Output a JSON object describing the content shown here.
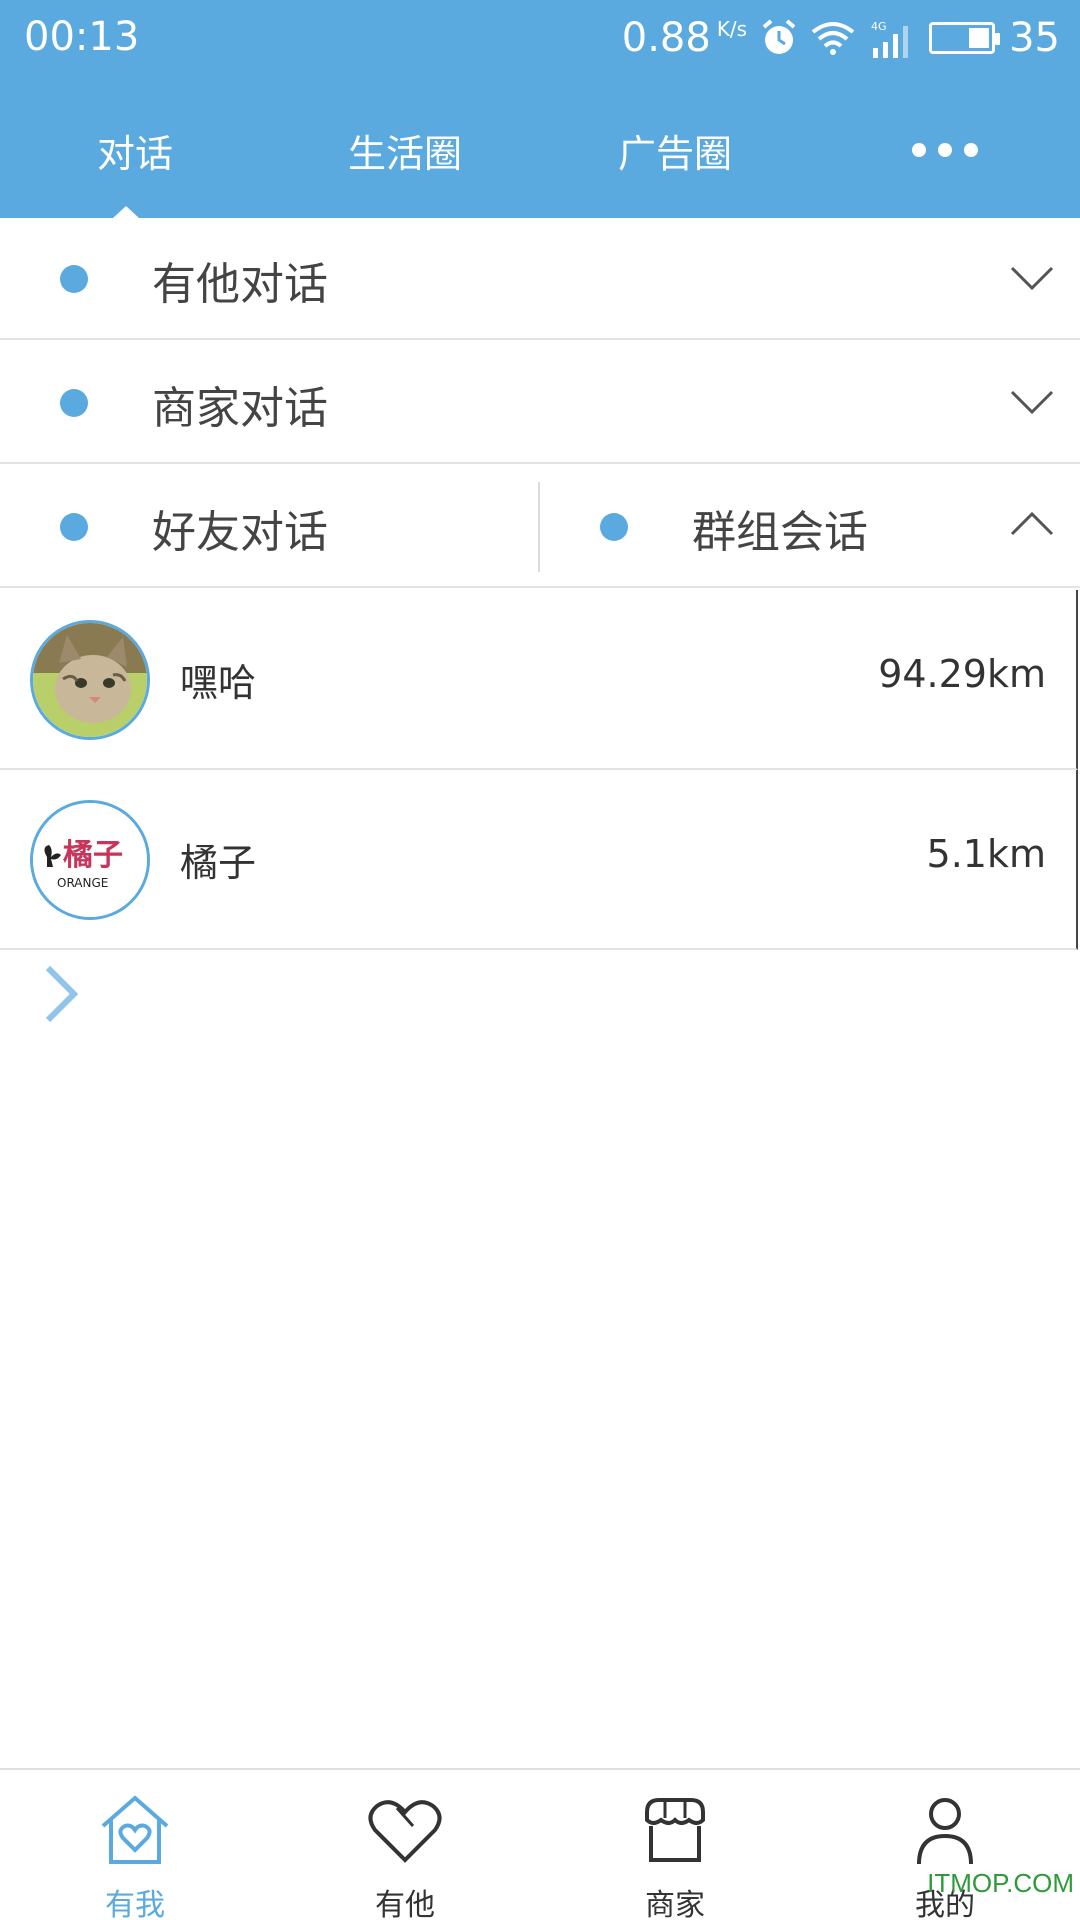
{
  "status_bar": {
    "time": "00:13",
    "speed": "0.88",
    "speed_unit": "K/s",
    "network": "4G",
    "battery": "35"
  },
  "top_tabs": [
    {
      "label": "对话",
      "active": true
    },
    {
      "label": "生活圈",
      "active": false
    },
    {
      "label": "广告圈",
      "active": false
    }
  ],
  "sections": [
    {
      "label": "有他对话",
      "expanded": false
    },
    {
      "label": "商家对话",
      "expanded": false
    }
  ],
  "split_section": {
    "left_label": "好友对话",
    "right_label": "群组会话",
    "expanded": true
  },
  "chats": [
    {
      "name": "嘿哈",
      "distance": "94.29km",
      "avatar": "cat-photo"
    },
    {
      "name": "橘子",
      "distance": "5.1km",
      "avatar": "orange-logo",
      "logo_text": "橘子",
      "logo_sub": "ORANGE"
    }
  ],
  "bottom_nav": [
    {
      "label": "有我",
      "icon": "house-heart-icon",
      "active": true
    },
    {
      "label": "有他",
      "icon": "heart-icon",
      "active": false
    },
    {
      "label": "商家",
      "icon": "shop-icon",
      "active": false
    },
    {
      "label": "我的",
      "icon": "user-icon",
      "active": false
    }
  ],
  "watermark": "ITMOP.COM",
  "colors": {
    "accent": "#5aaae0",
    "divider": "#e3e3e3"
  }
}
